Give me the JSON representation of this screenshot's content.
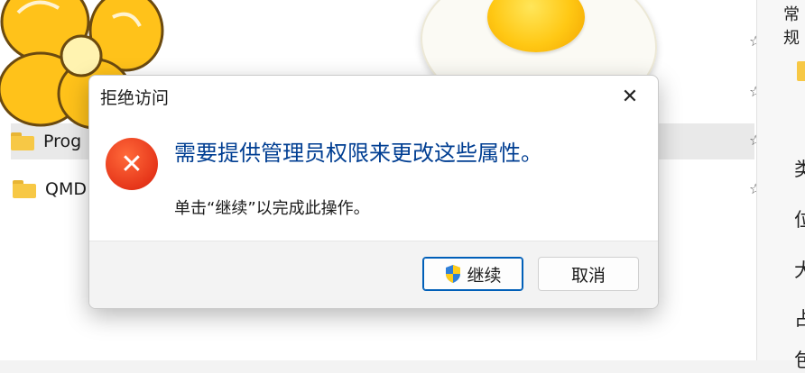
{
  "explorer": {
    "rows": [
      {
        "label": "Prog",
        "selected": true
      },
      {
        "label": "QMD",
        "selected": false
      }
    ],
    "pin_glyph": "☆",
    "right_title": "常规",
    "right_chars": [
      "类",
      "位",
      "大",
      "占",
      "包"
    ]
  },
  "dialog": {
    "title": "拒绝访问",
    "close_glyph": "✕",
    "icon": "error-icon",
    "icon_glyph": "✕",
    "instruction": "需要提供管理员权限来更改这些属性。",
    "message": "单击“继续”以完成此操作。",
    "continue_label": "继续",
    "cancel_label": "取消",
    "instruction_color": "#003e92",
    "accent_color": "#005fb8"
  }
}
